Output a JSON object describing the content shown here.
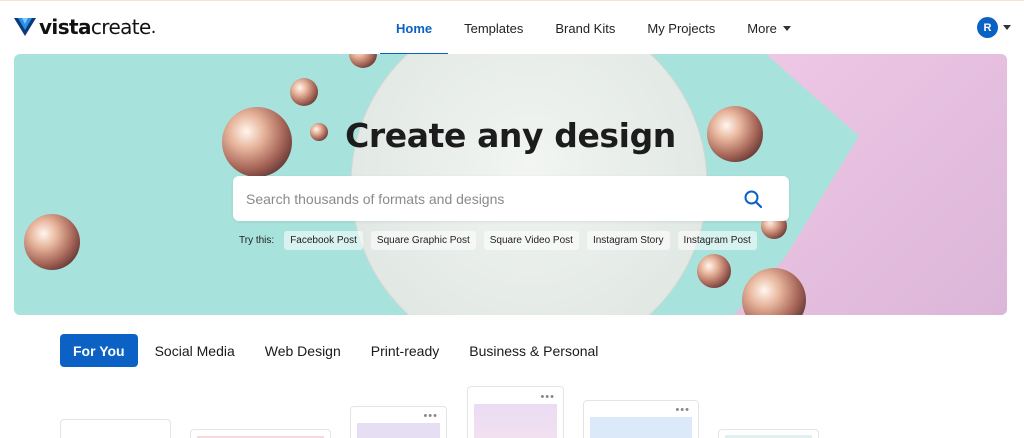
{
  "header": {
    "logo_bold": "vista",
    "logo_light": "create",
    "logo_dot": ".",
    "nav": [
      {
        "label": "Home",
        "active": true
      },
      {
        "label": "Templates"
      },
      {
        "label": "Brand Kits"
      },
      {
        "label": "My Projects"
      },
      {
        "label": "More"
      }
    ],
    "avatar_initial": "R"
  },
  "hero": {
    "title": "Create any design",
    "search_placeholder": "Search thousands of formats and designs",
    "try_label": "Try this:",
    "suggestions": [
      "Facebook Post",
      "Square Graphic Post",
      "Square Video Post",
      "Instagram Story",
      "Instagram Post"
    ]
  },
  "tabs": [
    {
      "label": "For You",
      "active": true
    },
    {
      "label": "Social Media"
    },
    {
      "label": "Web Design"
    },
    {
      "label": "Print-ready"
    },
    {
      "label": "Business & Personal"
    }
  ],
  "card_menu": "•••",
  "colors": {
    "accent": "#0b62c4",
    "hero_teal": "#a8e2dc",
    "hero_pink": "#e8c4e0",
    "pearl": "#d9a48c"
  },
  "icons": {
    "logo": "vistacreate-logo-icon",
    "search": "search-icon",
    "caret": "chevron-down-icon"
  }
}
